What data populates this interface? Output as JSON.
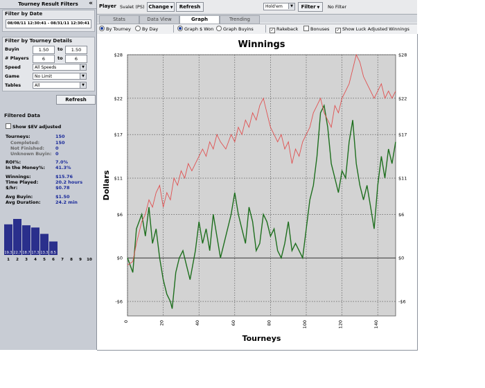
{
  "sidebar": {
    "header": "Tourney Result Filters",
    "collapse_icon": "«",
    "date": {
      "title": "Filter by Date",
      "range": "08/08/11 12:30:41 - 08/31/11 12:30:41"
    },
    "details": {
      "title": "Filter by Tourney Details",
      "buyin": {
        "label": "Buyin",
        "from": "1.50",
        "to_label": "to",
        "to": "1.50"
      },
      "players": {
        "label": "# Players",
        "from": "6",
        "to_label": "to",
        "to": "6"
      },
      "speed": {
        "label": "Speed",
        "value": "All Speeds"
      },
      "game": {
        "label": "Game",
        "value": "No Limit"
      },
      "tables": {
        "label": "Tables",
        "value": "All"
      }
    },
    "refresh_label": "Refresh",
    "filtered": {
      "title": "Filtered Data",
      "show_sev": "Show $EV adjusted",
      "stats": [
        {
          "label": "Tourneys:",
          "value": "150"
        },
        {
          "label": "Completed:",
          "value": "150"
        },
        {
          "label": "Not Finished:",
          "value": "0"
        },
        {
          "label": "Unknown Buyin:",
          "value": "0"
        },
        {
          "label": "ROI%:",
          "value": "7.0%"
        },
        {
          "label": "In the Money%:",
          "value": "41.3%"
        },
        {
          "label": "Winnings:",
          "value": "$15.76"
        },
        {
          "label": "Time Played:",
          "value": "20.2 hours"
        },
        {
          "label": "$/hr:",
          "value": "$0.78"
        },
        {
          "label": "Avg Buyin:",
          "value": "$1.50"
        },
        {
          "label": "Avg Duration:",
          "value": "24.2 min"
        }
      ]
    },
    "finish_histogram": {
      "positions": [
        "1",
        "2",
        "3",
        "4",
        "5",
        "6",
        "7",
        "8",
        "9",
        "10"
      ],
      "labels": [
        "19.3",
        "22.7",
        "18.7",
        "17.3",
        "13.3",
        "8.5",
        "",
        "",
        "",
        ""
      ],
      "values": [
        19.3,
        22.7,
        18.7,
        17.3,
        13.3,
        8.5,
        0,
        0,
        0,
        0
      ],
      "bar_color": "#2a2f8c"
    }
  },
  "topbar": {
    "player_label": "Player",
    "player_name": "Svalet (PS)",
    "change_label": "Change",
    "refresh_label": "Refresh",
    "game_select": "Hold'em",
    "filter_label": "Filter",
    "filter_status": "No Filter"
  },
  "tabs": [
    "Stats",
    "Data View",
    "Graph",
    "Trending"
  ],
  "active_tab": "Graph",
  "options": {
    "by_tourney": "By Tourney",
    "by_day": "By Day",
    "graph_won": "Graph $ Won",
    "graph_buyins": "Graph Buyins",
    "rakeback": "Rakeback",
    "bonuses": "Bonuses",
    "luck_adjusted": "Show Luck Adjusted Winnings"
  },
  "chart_data": {
    "type": "line",
    "title": "Winnings",
    "xlabel": "Tourneys",
    "ylabel": "Dollars",
    "xlim": [
      0,
      150
    ],
    "ylim": [
      -8,
      28
    ],
    "y_ticks": [
      -6,
      0,
      6,
      11,
      17,
      22,
      28
    ],
    "y_tick_labels": [
      "-$6",
      "$0",
      "$6",
      "$11",
      "$17",
      "$22",
      "$28"
    ],
    "x_ticks": [
      0,
      20,
      40,
      60,
      80,
      100,
      120,
      140
    ],
    "grid": true,
    "background": "#d3d3d3",
    "series": [
      {
        "color": "#1d6e1d",
        "x": [
          0,
          3,
          5,
          8,
          10,
          12,
          14,
          16,
          18,
          20,
          22,
          24,
          25,
          27,
          29,
          31,
          33,
          35,
          38,
          40,
          42,
          44,
          46,
          48,
          50,
          52,
          55,
          58,
          60,
          62,
          64,
          66,
          68,
          70,
          72,
          74,
          76,
          78,
          80,
          82,
          84,
          86,
          88,
          90,
          92,
          94,
          96,
          98,
          100,
          102,
          104,
          106,
          108,
          110,
          112,
          114,
          116,
          118,
          120,
          122,
          124,
          126,
          128,
          130,
          132,
          134,
          136,
          138,
          140,
          142,
          144,
          146,
          148,
          150
        ],
        "y": [
          0,
          -2,
          4,
          6,
          3,
          7,
          2,
          4,
          0,
          -3,
          -5,
          -6,
          -7,
          -2,
          0,
          1,
          -1,
          -3,
          1,
          5,
          2,
          4,
          1,
          6,
          3,
          0,
          3,
          6,
          9,
          6,
          4,
          2,
          7,
          5,
          1,
          2,
          6,
          5,
          3,
          4,
          1,
          0,
          2,
          5,
          1,
          2,
          1,
          0,
          4,
          8,
          10,
          14,
          20,
          21,
          18,
          13,
          11,
          9,
          12,
          11,
          16,
          19,
          13,
          10,
          8,
          10,
          7,
          4,
          10,
          14,
          11,
          15,
          13,
          16
        ]
      },
      {
        "color": "#e05050",
        "x": [
          0,
          3,
          5,
          8,
          10,
          12,
          14,
          16,
          18,
          20,
          22,
          24,
          26,
          28,
          30,
          32,
          34,
          36,
          38,
          40,
          42,
          44,
          46,
          48,
          50,
          52,
          55,
          58,
          60,
          62,
          64,
          66,
          68,
          70,
          72,
          74,
          76,
          78,
          80,
          82,
          84,
          86,
          88,
          90,
          92,
          94,
          96,
          98,
          100,
          102,
          104,
          106,
          108,
          110,
          112,
          114,
          116,
          118,
          120,
          122,
          124,
          126,
          128,
          130,
          132,
          134,
          136,
          138,
          140,
          142,
          144,
          146,
          148,
          150
        ],
        "y": [
          -1,
          -0.5,
          2,
          5,
          6,
          8,
          7,
          9,
          10,
          7,
          9,
          8,
          11,
          10,
          12,
          11,
          13,
          12,
          13,
          14,
          15,
          14,
          16,
          15,
          17,
          16,
          15,
          17,
          16,
          18,
          17,
          19,
          18,
          20,
          19,
          21,
          22,
          20,
          18,
          17,
          16,
          17,
          15,
          16,
          13,
          15,
          14,
          16,
          17,
          18,
          20,
          21,
          22,
          20,
          19,
          18,
          21,
          20,
          22,
          23,
          24,
          26,
          28,
          27,
          25,
          24,
          23,
          22,
          23,
          24,
          22,
          23,
          22,
          23
        ]
      }
    ]
  }
}
